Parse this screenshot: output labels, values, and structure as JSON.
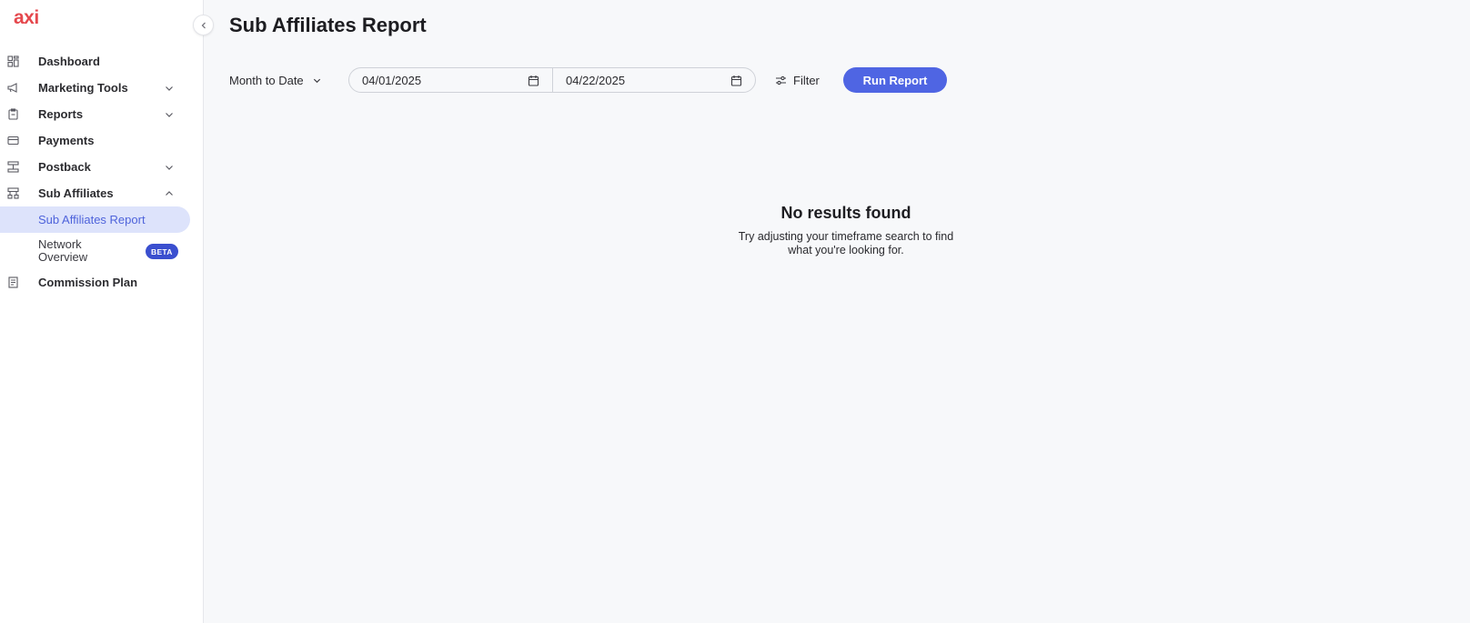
{
  "brand": {
    "logo_text": "axi",
    "logo_color": "#e5484d"
  },
  "sidebar": {
    "collapse_icon": "chevron-left-icon",
    "items": [
      {
        "label": "Dashboard",
        "icon": "dashboard-icon"
      },
      {
        "label": "Marketing Tools",
        "icon": "megaphone-icon",
        "expand": "chevron-down-icon"
      },
      {
        "label": "Reports",
        "icon": "clipboard-icon",
        "expand": "chevron-down-icon"
      },
      {
        "label": "Payments",
        "icon": "credit-card-icon"
      },
      {
        "label": "Postback",
        "icon": "postback-icon",
        "expand": "chevron-down-icon"
      },
      {
        "label": "Sub Affiliates",
        "icon": "hierarchy-icon",
        "expand": "chevron-up-icon"
      },
      {
        "label": "Commission Plan",
        "icon": "document-icon"
      }
    ],
    "sub_items": [
      {
        "label": "Sub Affiliates Report",
        "active": true
      },
      {
        "label": "Network Overview",
        "badge": "BETA"
      }
    ]
  },
  "main": {
    "title": "Sub Affiliates Report",
    "range": {
      "selected": "Month to Date"
    },
    "date_from": "04/01/2025",
    "date_to": "04/22/2025",
    "filter_label": "Filter",
    "run_label": "Run Report",
    "empty": {
      "title": "No results found",
      "text": "Try adjusting your timeframe search to find what you're looking for."
    }
  },
  "colors": {
    "accent": "#4f65e3",
    "active_bg": "#dde3fb",
    "badge": "#3a4fcf"
  }
}
